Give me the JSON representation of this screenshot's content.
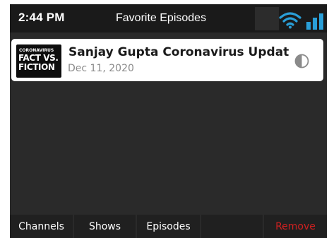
{
  "status_bar": {
    "time": "2:44 PM",
    "title": "Favorite Episodes",
    "wifi_icon": "wifi-icon",
    "signal_icon": "signal-bars-icon",
    "accent_color": "#2a9fd8"
  },
  "favorites": [
    {
      "thumbnail_lines": [
        "CORONAVIRUS",
        "FACT VS.",
        "FICTION"
      ],
      "title": "Sanjay Gupta Coronavirus Updat",
      "date": "Dec 11, 2020",
      "progress_icon": "half-played-icon"
    }
  ],
  "tabs": {
    "channels": "Channels",
    "shows": "Shows",
    "episodes": "Episodes",
    "empty": "",
    "remove": "Remove",
    "remove_color": "#d02020"
  }
}
